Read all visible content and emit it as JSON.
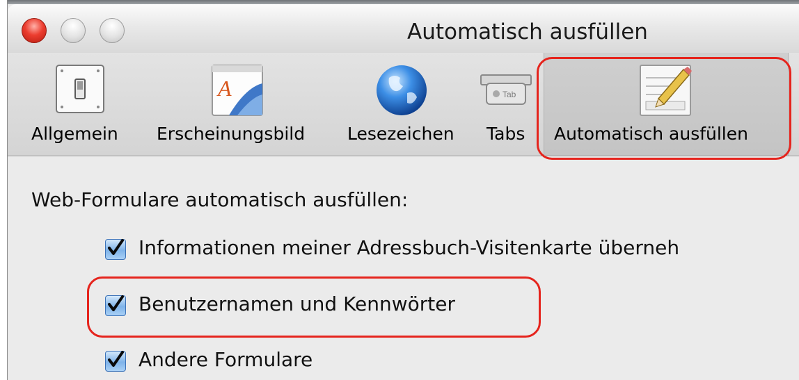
{
  "window": {
    "title": "Automatisch ausfüllen"
  },
  "toolbar": {
    "items": [
      {
        "label": "Allgemein",
        "icon": "switch-icon"
      },
      {
        "label": "Erscheinungsbild",
        "icon": "font-icon"
      },
      {
        "label": "Lesezeichen",
        "icon": "globe-icon"
      },
      {
        "label": "Tabs",
        "icon": "tab-icon"
      },
      {
        "label": "Automatisch ausfüllen",
        "icon": "pencil-form-icon",
        "selected": true
      }
    ]
  },
  "content": {
    "section_label": "Web-Formulare automatisch ausfüllen:",
    "options": [
      {
        "label": "Informationen meiner Adressbuch-Visitenkarte überneh",
        "checked": true
      },
      {
        "label": "Benutzernamen und Kennwörter",
        "checked": true
      },
      {
        "label": "Andere Formulare",
        "checked": true
      }
    ]
  },
  "colors": {
    "highlight": "#e5241d",
    "checkbox": "#7fb3e9",
    "close_button": "#ec3d2f"
  }
}
